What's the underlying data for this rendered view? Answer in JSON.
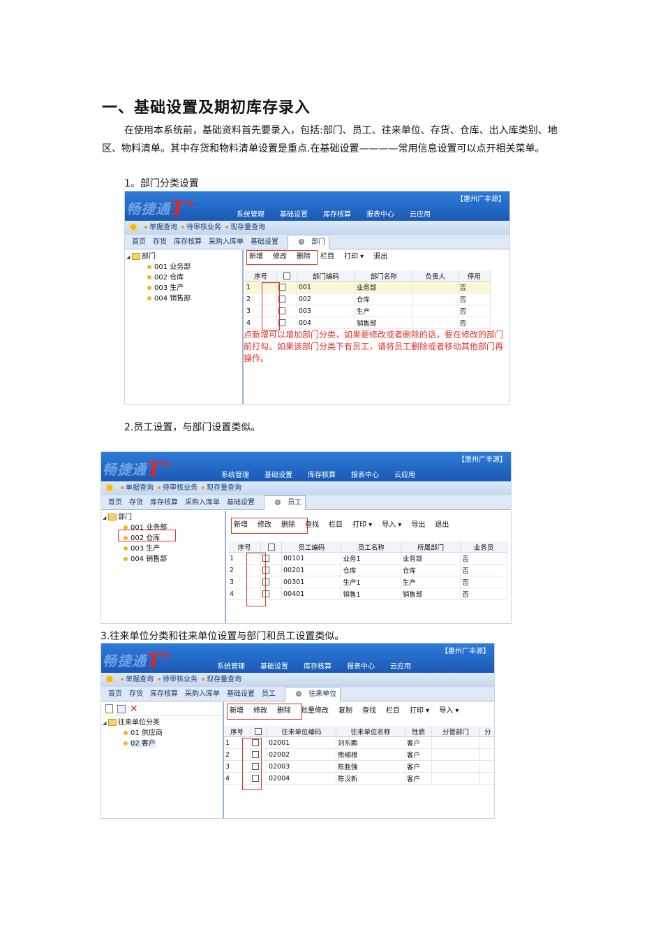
{
  "doc": {
    "title": "一、基础设置及期初库存录入",
    "intro": "在使用本系统前，基础资料首先要录入，包括:部门、员工、往来单位、存货、仓库、出入库类别、地区、物料清单。其中存货和物料清单设置是重点.在基础设置————常用信息设置可以点开相关菜单。",
    "h1": "1。部门分类设置",
    "h2": "2.员工设置，与部门设置类似。",
    "h3": "3.往来单位分类和往来单位设置与部门和员工设置类似。"
  },
  "app": {
    "logo_text": "畅捷通",
    "logo_t": "T",
    "logo_plus": "+",
    "company": "【惠州广丰源】",
    "top_nav": [
      "系统管理",
      "基础设置",
      "库存核算",
      "报表中心",
      "云应用"
    ],
    "quick": [
      "单据查询",
      "待审核业务",
      "现存量查询"
    ],
    "colors": {
      "banner": "#1b59b5",
      "highlight": "#e0322b"
    }
  },
  "shot1": {
    "tabs": [
      "首页",
      "存货",
      "库存核算",
      "采购入库单",
      "基础设置"
    ],
    "active_tab": "部门",
    "tree_root": "部门",
    "tree": [
      "001 业务部",
      "002 仓库",
      "003 生产",
      "004 销售部"
    ],
    "toolbar": [
      "新增",
      "修改",
      "删除",
      "栏目",
      "打印 ▾",
      "退出"
    ],
    "columns": [
      "序号",
      "",
      "部门编码",
      "部门名称",
      "负责人",
      "停用"
    ],
    "rows": [
      [
        "1",
        "001",
        "业务部",
        "",
        "否"
      ],
      [
        "2",
        "002",
        "仓库",
        "",
        "否"
      ],
      [
        "3",
        "003",
        "生产",
        "",
        "否"
      ],
      [
        "4",
        "004",
        "销售部",
        "",
        "否"
      ]
    ],
    "note": "点新增可以增加部门分类，如果要修改或者删除的话，要在修改的部门前打勾。如果该部门分类下有员工，请将员工删除或者移动其他部门再操作。"
  },
  "shot2": {
    "tabs": [
      "首页",
      "存货",
      "库存核算",
      "采购入库单",
      "基础设置"
    ],
    "active_tab": "员工",
    "tree_root": "部门",
    "tree": [
      "001 业务部",
      "002 仓库",
      "003 生产",
      "004 销售部"
    ],
    "toolbar": [
      "新增",
      "修改",
      "删除",
      "查找",
      "栏目",
      "打印 ▾",
      "导入 ▾",
      "导出",
      "退出"
    ],
    "columns": [
      "序号",
      "",
      "员工编码",
      "员工名称",
      "所属部门",
      "业务员"
    ],
    "rows": [
      [
        "1",
        "00101",
        "业务1",
        "业务部",
        "否"
      ],
      [
        "2",
        "00201",
        "仓库",
        "仓库",
        "否"
      ],
      [
        "3",
        "00301",
        "生产1",
        "生产",
        "否"
      ],
      [
        "4",
        "00401",
        "销售1",
        "销售部",
        "否"
      ]
    ]
  },
  "shot3": {
    "tabs": [
      "首页",
      "存货",
      "库存核算",
      "采购入库单",
      "基础设置",
      "员工"
    ],
    "active_tab": "往来单位",
    "tree_root": "往来单位分类",
    "tree": [
      "01 供应商",
      "02 客户"
    ],
    "toolbar": [
      "新增",
      "修改",
      "删除",
      "批量修改",
      "复制",
      "查找",
      "栏目",
      "打印 ▾",
      "导入 ▾"
    ],
    "columns": [
      "序号",
      "",
      "往来单位编码",
      "往来单位名称",
      "性质",
      "分管部门",
      "分"
    ],
    "rows": [
      [
        "1",
        "02001",
        "刘东鹏",
        "客户",
        ""
      ],
      [
        "2",
        "02002",
        "熊细根",
        "客户",
        ""
      ],
      [
        "3",
        "02003",
        "陈胜强",
        "客户",
        ""
      ],
      [
        "4",
        "02004",
        "陈汉新",
        "客户",
        ""
      ]
    ]
  }
}
